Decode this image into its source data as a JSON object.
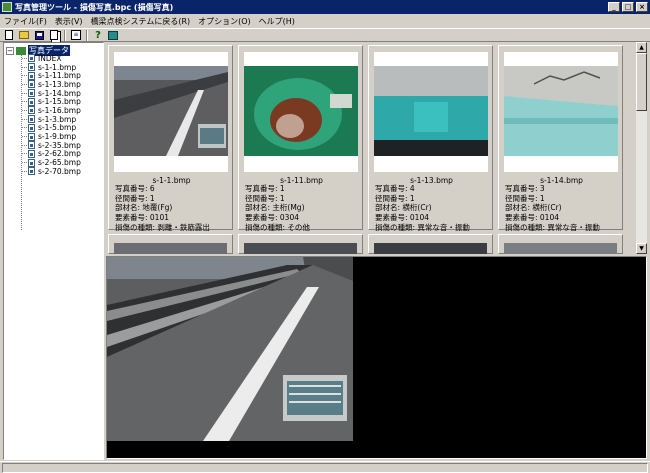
{
  "window": {
    "title": "写真管理ツール - 損傷写真.bpc (損傷写真)",
    "buttons": {
      "minimize": "_",
      "maximize": "□",
      "close": "×"
    }
  },
  "menu": [
    {
      "label": "ファイル(F)"
    },
    {
      "label": "表示(V)"
    },
    {
      "label": "橋梁点検システムに戻る(R)"
    },
    {
      "label": "オプション(O)"
    },
    {
      "label": "ヘルプ(H)"
    }
  ],
  "toolbar": {
    "icons": [
      "new-file-icon",
      "open-folder-icon",
      "save-icon",
      "copy-icon",
      "properties-icon",
      "help-icon",
      "window-icon"
    ],
    "help_glyph": "?"
  },
  "tree": {
    "root_label": "写真データ",
    "expander": "−",
    "items": [
      "INDEX",
      "s-1-1.bmp",
      "s-1-11.bmp",
      "s-1-13.bmp",
      "s-1-14.bmp",
      "s-1-15.bmp",
      "s-1-16.bmp",
      "s-1-3.bmp",
      "s-1-5.bmp",
      "s-1-9.bmp",
      "s-2-35.bmp",
      "s-2-62.bmp",
      "s-2-65.bmp",
      "s-2-70.bmp"
    ]
  },
  "thumbnails": [
    {
      "filename": "s-1-1.bmp",
      "photo_no": "写真番号: 6",
      "span_no": "径間番号: 1",
      "member": "部材名: 地覆(Fg)",
      "element_no": "要素番号: 0101",
      "damage": "損傷の種類: 剥離・鉄筋露出"
    },
    {
      "filename": "s-1-11.bmp",
      "photo_no": "写真番号: 1",
      "span_no": "径間番号: 1",
      "member": "部材名: 主桁(Mg)",
      "element_no": "要素番号: 0304",
      "damage": "損傷の種類: その他"
    },
    {
      "filename": "s-1-13.bmp",
      "photo_no": "写真番号: 4",
      "span_no": "径間番号: 1",
      "member": "部材名: 横桁(Cr)",
      "element_no": "要素番号: 0104",
      "damage": "損傷の種類: 異常な音・振動"
    },
    {
      "filename": "s-1-14.bmp",
      "photo_no": "写真番号: 3",
      "span_no": "径間番号: 1",
      "member": "部材名: 横桁(Cr)",
      "element_no": "要素番号: 0104",
      "damage": "損傷の種類: 異常な音・振動"
    }
  ],
  "scrollbar": {
    "up": "▲",
    "down": "▼"
  }
}
